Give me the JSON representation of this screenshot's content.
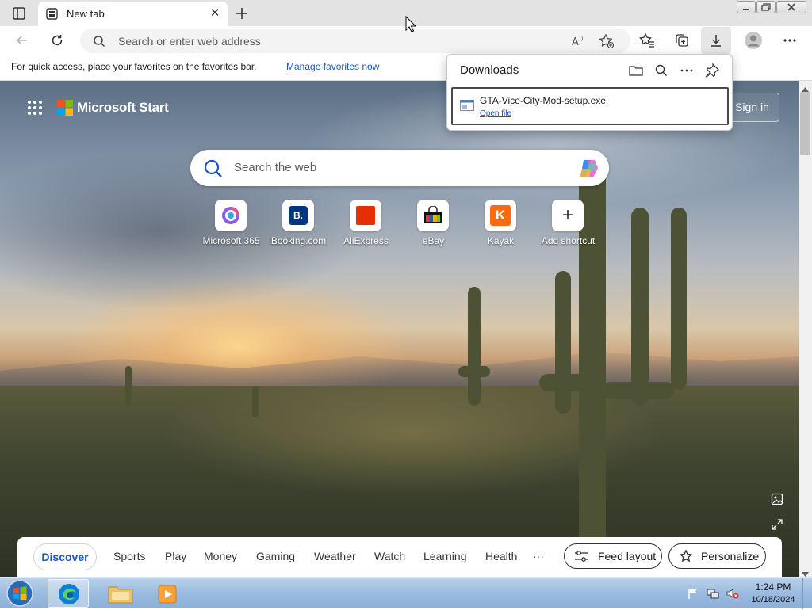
{
  "browser": {
    "tab": {
      "title": "New tab"
    },
    "address_bar": {
      "placeholder": "Search or enter web address"
    },
    "favorites_bar": {
      "message": "For quick access, place your favorites on the favorites bar.",
      "link": "Manage favorites now"
    }
  },
  "downloads": {
    "title": "Downloads",
    "items": [
      {
        "file_name": "GTA-Vice-City-Mod-setup.exe",
        "action": "Open file"
      }
    ]
  },
  "start_page": {
    "brand": "Microsoft Start",
    "sign_in": "Sign in",
    "search_placeholder": "Search the web",
    "shortcuts": [
      {
        "label": "Microsoft 365",
        "icon": "microsoft-365-icon"
      },
      {
        "label": "Booking.com",
        "icon": "booking-icon",
        "glyph": "B."
      },
      {
        "label": "AliExpress",
        "icon": "aliexpress-icon"
      },
      {
        "label": "eBay",
        "icon": "ebay-icon"
      },
      {
        "label": "Kayak",
        "icon": "kayak-icon",
        "glyph": "K"
      },
      {
        "label": "Add shortcut",
        "icon": "plus-icon",
        "glyph": "+"
      }
    ],
    "feed_tabs": [
      "Discover",
      "Sports",
      "Play",
      "Money",
      "Gaming",
      "Weather",
      "Watch",
      "Learning",
      "Health",
      "···"
    ],
    "feed_layout": "Feed layout",
    "personalize": "Personalize"
  },
  "taskbar": {
    "time": "1:24 PM",
    "date": "10/18/2024"
  },
  "colors": {
    "accent": "#1a56c2",
    "edge_blue": "#0c7fd6",
    "taskbar": "#9bbbe0"
  }
}
